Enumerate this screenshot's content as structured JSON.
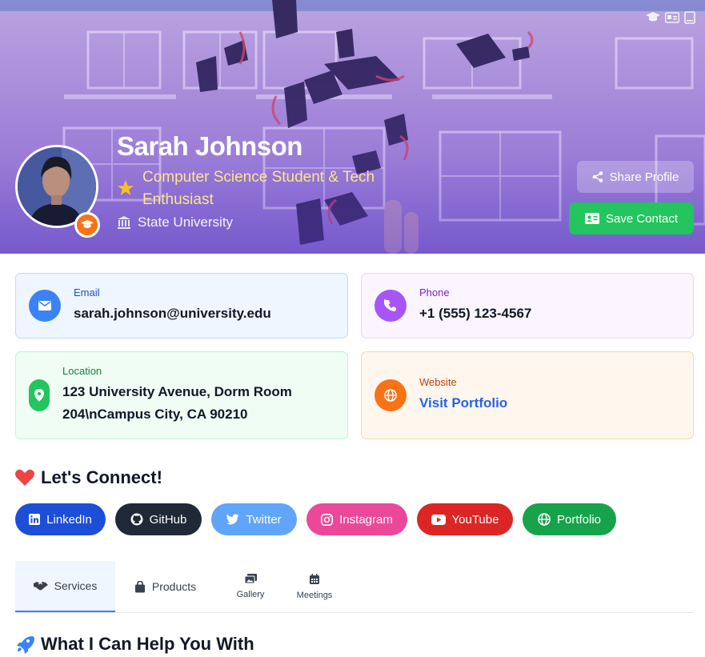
{
  "hero": {
    "name": "Sarah Johnson",
    "title": "Computer Science Student & Tech Enthusiast",
    "university": "State University",
    "corner_icons": [
      "graduation-cap-icon",
      "id-card-icon",
      "book-icon"
    ]
  },
  "actions": {
    "share_label": "Share Profile",
    "save_label": "Save Contact"
  },
  "contact": {
    "email": {
      "label": "Email",
      "value": "sarah.johnson@university.edu"
    },
    "phone": {
      "label": "Phone",
      "value": "+1 (555) 123-4567"
    },
    "location": {
      "label": "Location",
      "value": "123 University Avenue, Dorm Room 204\\nCampus City, CA 90210"
    },
    "website": {
      "label": "Website",
      "value": "Visit Portfolio"
    }
  },
  "connect": {
    "heading": "Let's Connect!",
    "links": [
      {
        "label": "LinkedIn",
        "icon": "linkedin-icon",
        "color": "#1d4ed8"
      },
      {
        "label": "GitHub",
        "icon": "github-icon",
        "color": "#1f2937"
      },
      {
        "label": "Twitter",
        "icon": "twitter-icon",
        "color": "#60a5fa"
      },
      {
        "label": "Instagram",
        "icon": "instagram-icon",
        "color": "#ec4899"
      },
      {
        "label": "YouTube",
        "icon": "youtube-icon",
        "color": "#dc2626"
      },
      {
        "label": "Portfolio",
        "icon": "globe-icon",
        "color": "#16a34a"
      }
    ]
  },
  "tabs": [
    {
      "label": "Services",
      "active": true
    },
    {
      "label": "Products"
    },
    {
      "label": "Gallery"
    },
    {
      "label": "Meetings"
    }
  ],
  "services": {
    "heading": "What I Can Help You With"
  }
}
